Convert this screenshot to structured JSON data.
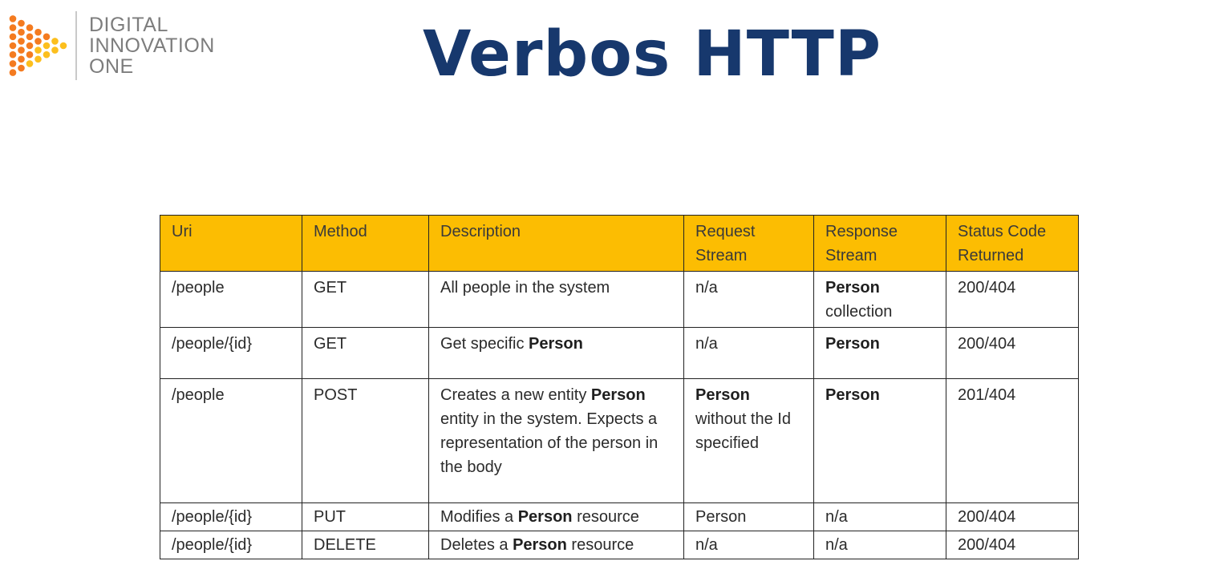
{
  "logo": {
    "line1": "DIGITAL",
    "line2": "INNOVATION",
    "line3": "ONE"
  },
  "title": "Verbos HTTP",
  "colors": {
    "title": "#17386d",
    "header_fill": "#fcbd02",
    "logo_orange": "#f47b20",
    "logo_yellow": "#fcbf1e"
  },
  "table": {
    "headers": [
      "Uri",
      "Method",
      "Description",
      "Request Stream",
      "Response Stream",
      "Status Code Returned"
    ],
    "rows": [
      {
        "uri": "/people",
        "method": "GET",
        "description": {
          "pre": "All people in the system",
          "bold": "",
          "post": ""
        },
        "request": {
          "bold": "",
          "rest": "n/a"
        },
        "response": {
          "bold": "Person",
          "rest": "collection"
        },
        "status": "200/404"
      },
      {
        "uri": "/people/{id}",
        "method": "GET",
        "description": {
          "pre": "Get specific ",
          "bold": "Person",
          "post": ""
        },
        "request": {
          "bold": "",
          "rest": "n/a"
        },
        "response": {
          "bold": "Person",
          "rest": ""
        },
        "status": "200/404"
      },
      {
        "uri": "/people",
        "method": "POST",
        "description": {
          "pre": "Creates a new entity ",
          "bold": "Person",
          "post": " entity in the system. Expects a representation of the person in the body"
        },
        "request": {
          "bold": "Person",
          "rest": "without the Id specified"
        },
        "response": {
          "bold": "Person",
          "rest": ""
        },
        "status": "201/404"
      },
      {
        "uri": "/people/{id}",
        "method": "PUT",
        "description": {
          "pre": "Modifies a ",
          "bold": "Person",
          "post": " resource"
        },
        "request": {
          "bold": "",
          "rest": "Person"
        },
        "response": {
          "bold": "",
          "rest": "n/a"
        },
        "status": "200/404"
      },
      {
        "uri": "/people/{id}",
        "method": "DELETE",
        "description": {
          "pre": "Deletes a ",
          "bold": "Person",
          "post": " resource"
        },
        "request": {
          "bold": "",
          "rest": "n/a"
        },
        "response": {
          "bold": "",
          "rest": "n/a"
        },
        "status": "200/404"
      }
    ]
  }
}
